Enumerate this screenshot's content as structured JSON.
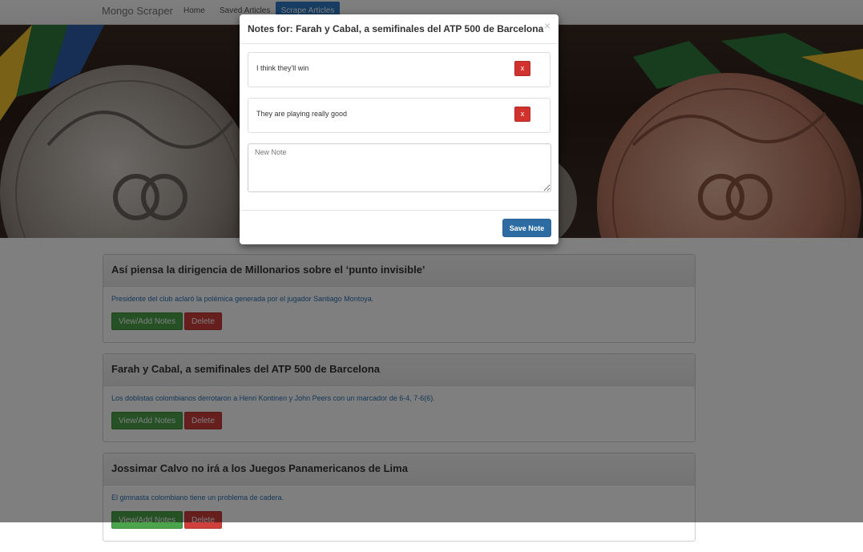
{
  "navbar": {
    "brand": "Mongo Scraper",
    "links": [
      "Home",
      "Saved Articles"
    ],
    "active_link": "Scrape Articles"
  },
  "articles": [
    {
      "title": "Así piensa la dirigencia de Millonarios sobre el ‘punto invisible’",
      "summary": "Presidente del club aclaró la polémica generada por el jugador Santiago Montoya.",
      "notes_button": "View/Add Notes",
      "delete_button": "Delete"
    },
    {
      "title": "Farah y Cabal, a semifinales del ATP 500 de Barcelona",
      "summary": "Los doblistas colombianos derrotaron a Henri Kontinen y John Peers con un marcador de 6-4, 7-6(6).",
      "notes_button": "View/Add Notes",
      "delete_button": "Delete"
    },
    {
      "title": "Jossimar Calvo no irá a los Juegos Panamericanos de Lima",
      "summary": "El gimnasta colombiano tiene un problema de cadera.",
      "notes_button": "View/Add Notes",
      "delete_button": "Delete"
    }
  ],
  "modal": {
    "title": "Notes for: Farah y Cabal, a semifinales del ATP 500 de Barcelona",
    "close_symbol": "×",
    "notes": [
      {
        "text": "I think they'll win",
        "delete_label": "x"
      },
      {
        "text": "They are playing really good",
        "delete_label": "x"
      }
    ],
    "new_note_placeholder": "New Note",
    "save_label": "Save Note"
  },
  "colors": {
    "primary": "#2d6ca2",
    "success": "#4ba34b",
    "danger": "#cf3f3b",
    "nav_active": "#2f7ac6"
  }
}
